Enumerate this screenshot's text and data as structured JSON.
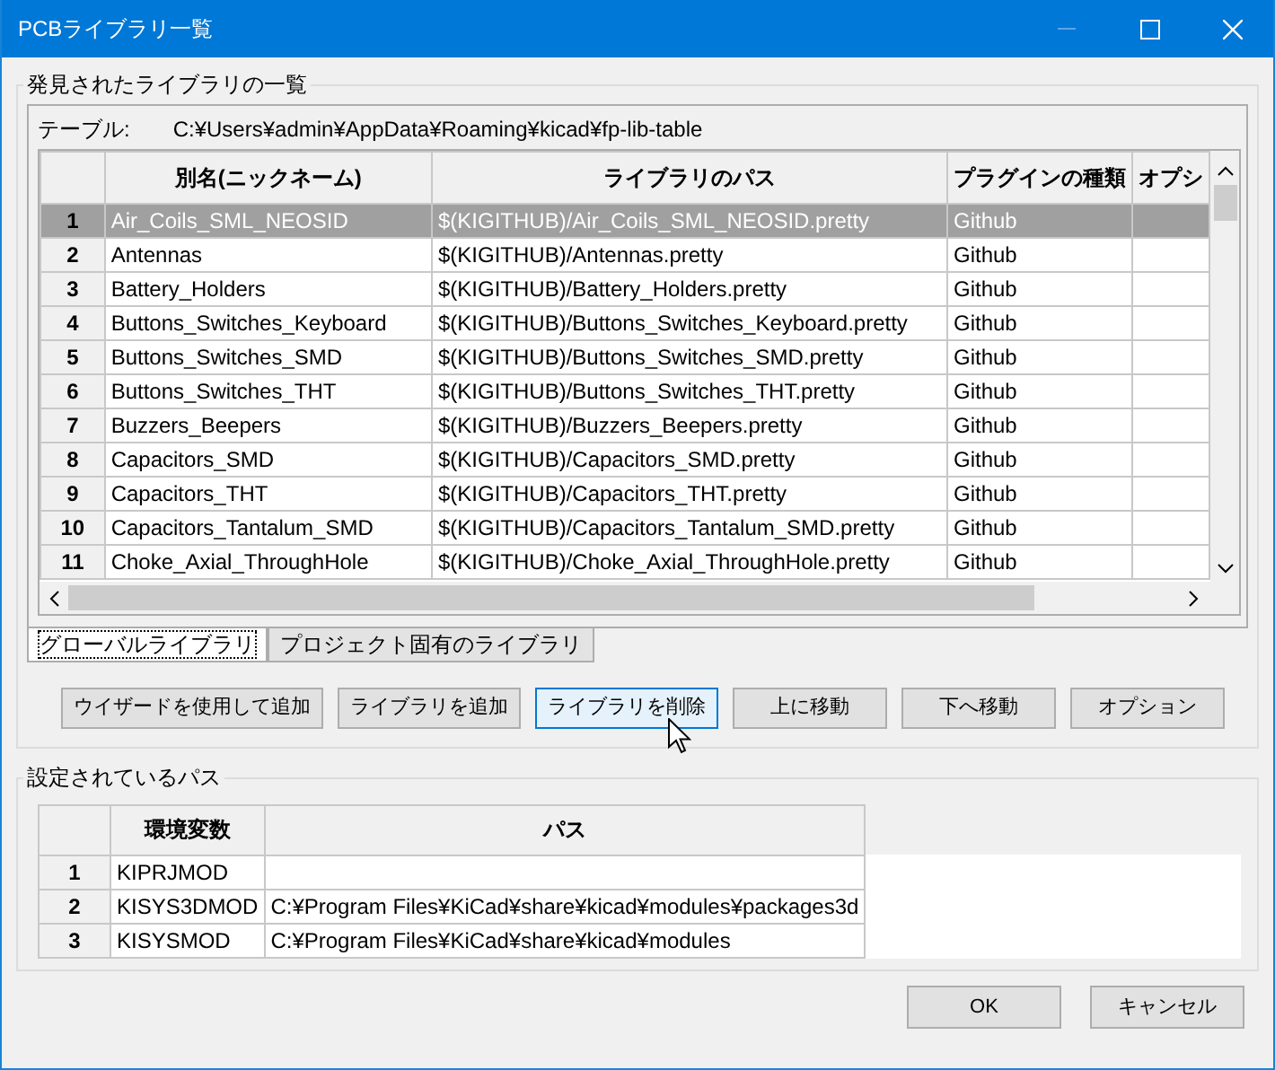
{
  "window": {
    "title": "PCBライブラリ一覧"
  },
  "library_group": {
    "legend": "発見されたライブラリの一覧",
    "table_label": "テーブル:",
    "table_path": "C:¥Users¥admin¥AppData¥Roaming¥kicad¥fp-lib-table",
    "table": {
      "columns": [
        "別名(ニックネーム)",
        "ライブラリのパス",
        "プラグインの種類",
        "オプシ"
      ],
      "rows": [
        {
          "number": "1",
          "nickname": "Air_Coils_SML_NEOSID",
          "path": "$(KIGITHUB)/Air_Coils_SML_NEOSID.pretty",
          "plugin": "Github",
          "selected": true
        },
        {
          "number": "2",
          "nickname": "Antennas",
          "path": "$(KIGITHUB)/Antennas.pretty",
          "plugin": "Github",
          "selected": false
        },
        {
          "number": "3",
          "nickname": "Battery_Holders",
          "path": "$(KIGITHUB)/Battery_Holders.pretty",
          "plugin": "Github",
          "selected": false
        },
        {
          "number": "4",
          "nickname": "Buttons_Switches_Keyboard",
          "path": "$(KIGITHUB)/Buttons_Switches_Keyboard.pretty",
          "plugin": "Github",
          "selected": false
        },
        {
          "number": "5",
          "nickname": "Buttons_Switches_SMD",
          "path": "$(KIGITHUB)/Buttons_Switches_SMD.pretty",
          "plugin": "Github",
          "selected": false
        },
        {
          "number": "6",
          "nickname": "Buttons_Switches_THT",
          "path": "$(KIGITHUB)/Buttons_Switches_THT.pretty",
          "plugin": "Github",
          "selected": false
        },
        {
          "number": "7",
          "nickname": "Buzzers_Beepers",
          "path": "$(KIGITHUB)/Buzzers_Beepers.pretty",
          "plugin": "Github",
          "selected": false
        },
        {
          "number": "8",
          "nickname": "Capacitors_SMD",
          "path": "$(KIGITHUB)/Capacitors_SMD.pretty",
          "plugin": "Github",
          "selected": false
        },
        {
          "number": "9",
          "nickname": "Capacitors_THT",
          "path": "$(KIGITHUB)/Capacitors_THT.pretty",
          "plugin": "Github",
          "selected": false
        },
        {
          "number": "10",
          "nickname": "Capacitors_Tantalum_SMD",
          "path": "$(KIGITHUB)/Capacitors_Tantalum_SMD.pretty",
          "plugin": "Github",
          "selected": false
        },
        {
          "number": "11",
          "nickname": "Choke_Axial_ThroughHole",
          "path": "$(KIGITHUB)/Choke_Axial_ThroughHole.pretty",
          "plugin": "Github",
          "selected": false
        }
      ]
    },
    "tabs": [
      {
        "label": "グローバルライブラリ",
        "selected": true
      },
      {
        "label": "プロジェクト固有のライブラリ",
        "selected": false
      }
    ],
    "buttons": [
      {
        "label": "ウイザードを使用して追加",
        "focused": false
      },
      {
        "label": "ライブラリを追加",
        "focused": false
      },
      {
        "label": "ライブラリを削除",
        "focused": true
      },
      {
        "label": "上に移動",
        "focused": false
      },
      {
        "label": "下へ移動",
        "focused": false
      },
      {
        "label": "オプション",
        "focused": false
      }
    ]
  },
  "paths_group": {
    "legend": "設定されているパス",
    "table": {
      "columns": [
        "環境変数",
        "パス"
      ],
      "rows": [
        {
          "number": "1",
          "variable": "KIPRJMOD"
        },
        {
          "number": "2",
          "variable": "KISYS3DMOD",
          "path": "C:¥Program Files¥KiCad¥share¥kicad¥modules¥packages3d"
        },
        {
          "number": "3",
          "variable": "KISYSMOD",
          "path": "C:¥Program Files¥KiCad¥share¥kicad¥modules"
        }
      ]
    }
  },
  "dialog_buttons": [
    "OK",
    "キャンセル"
  ]
}
